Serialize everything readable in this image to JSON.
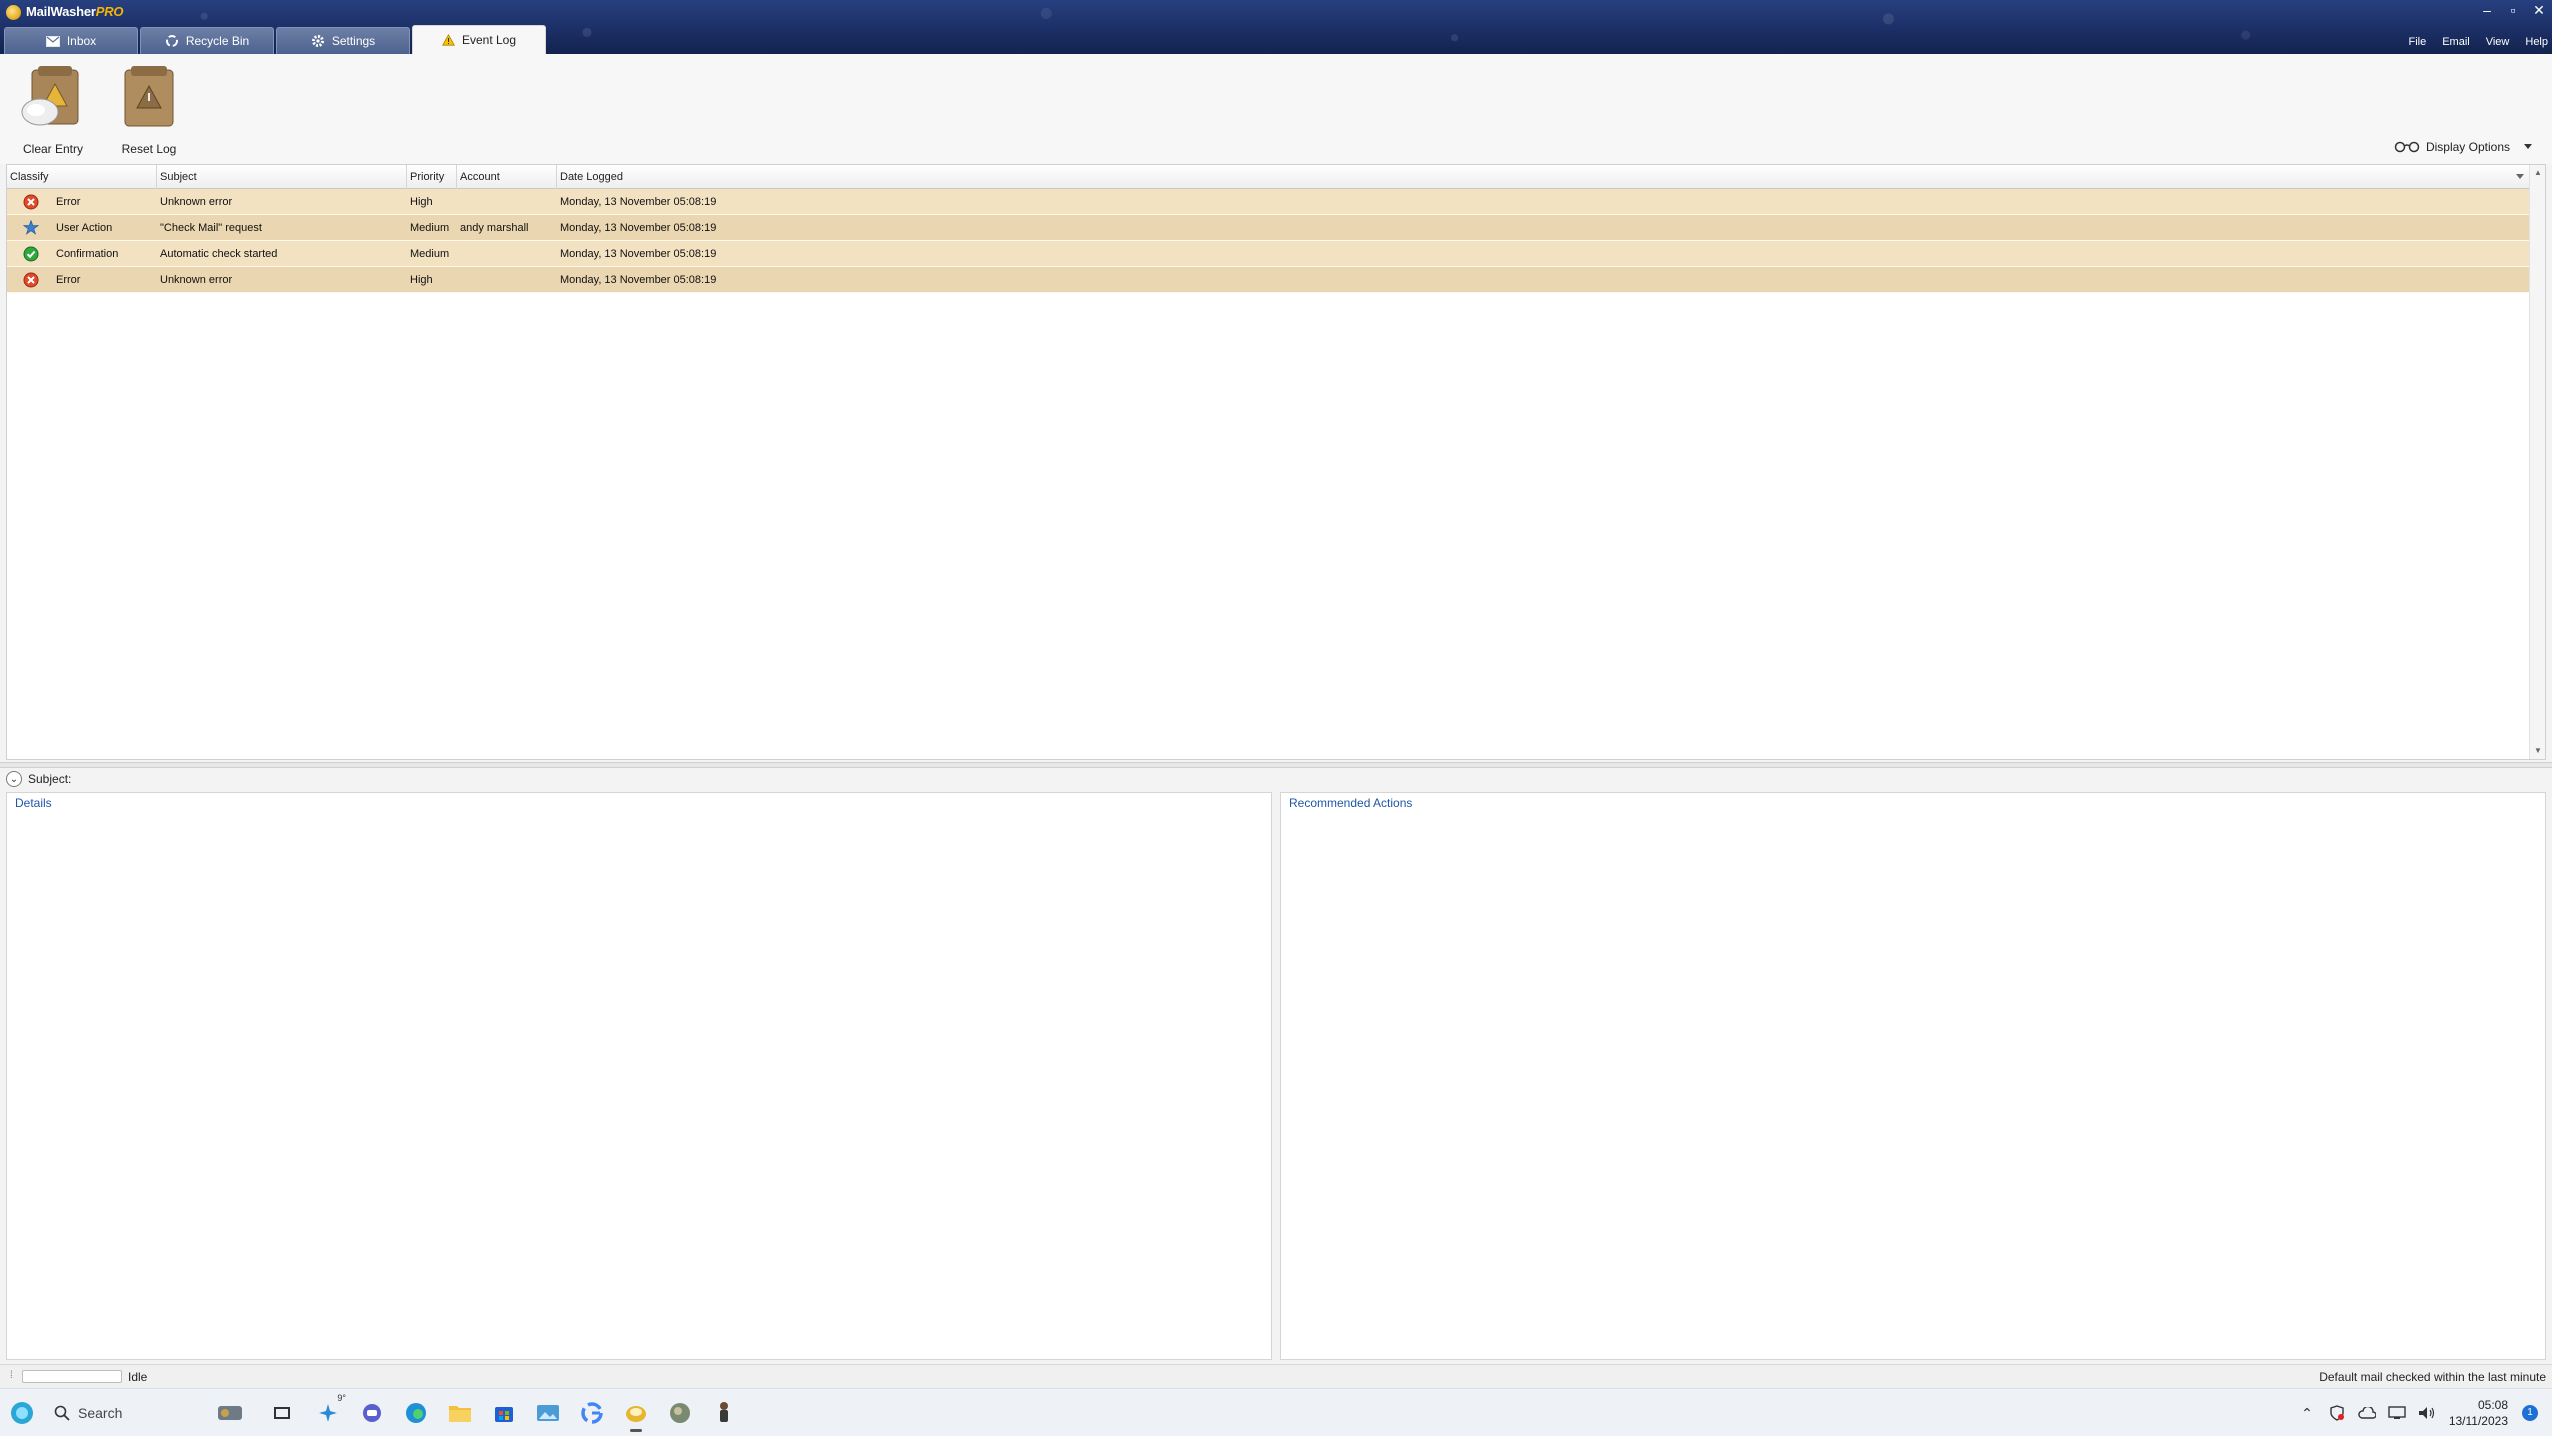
{
  "app": {
    "name": "MailWasher",
    "name_suffix": "PRO"
  },
  "menu": [
    "File",
    "Email",
    "View",
    "Help"
  ],
  "window_controls": {
    "minimize": "–",
    "restore": "▫",
    "close": "✕"
  },
  "tabs": [
    {
      "label": "Inbox",
      "icon": "mail-icon",
      "active": false
    },
    {
      "label": "Recycle Bin",
      "icon": "recycle-icon",
      "active": false
    },
    {
      "label": "Settings",
      "icon": "gear-icon",
      "active": false
    },
    {
      "label": "Event Log",
      "icon": "warning-icon",
      "active": true
    }
  ],
  "toolbar": {
    "clear_entry": "Clear Entry",
    "reset_log": "Reset Log",
    "display_options": "Display Options"
  },
  "grid": {
    "columns": [
      "Classify",
      "Subject",
      "Priority",
      "Account",
      "Date Logged"
    ],
    "rows": [
      {
        "classify": "Error",
        "icon": "error-icon",
        "subject": "Unknown error",
        "priority": "High",
        "account": "",
        "date": "Monday, 13 November 05:08:19"
      },
      {
        "classify": "User Action",
        "icon": "user-action-icon",
        "subject": "\"Check Mail\" request",
        "priority": "Medium",
        "account": "andy marshall",
        "date": "Monday, 13 November 05:08:19"
      },
      {
        "classify": "Confirmation",
        "icon": "confirmation-icon",
        "subject": "Automatic check started",
        "priority": "Medium",
        "account": "",
        "date": "Monday, 13 November 05:08:19"
      },
      {
        "classify": "Error",
        "icon": "error-icon",
        "subject": "Unknown error",
        "priority": "High",
        "account": "",
        "date": "Monday, 13 November 05:08:19"
      }
    ]
  },
  "detail": {
    "subject_label": "Subject:",
    "details_title": "Details",
    "actions_title": "Recommended Actions"
  },
  "status": {
    "left": "Idle",
    "right": "Default mail checked within the last minute"
  },
  "taskbar": {
    "search_placeholder": "Search",
    "weather": "9°",
    "time": "05:08",
    "date": "13/11/2023",
    "notification_count": "1"
  },
  "colors": {
    "titlebar": "#1c2f66",
    "row_bg": "#f2e2c2",
    "row_bg_alt": "#ead6b0",
    "link_blue": "#1f56a8"
  }
}
